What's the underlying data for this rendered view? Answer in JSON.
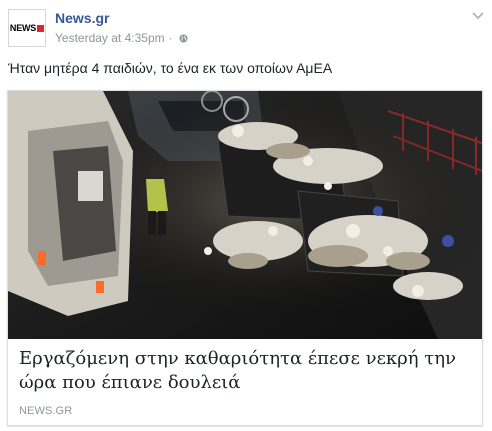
{
  "post": {
    "page_name": "News.gr",
    "timestamp": "Yesterday at 4:35pm",
    "separator": "·",
    "text": "Ήταν μητέρα 4 παιδιών, το ένα εκ των οποίων ΑμΕΑ"
  },
  "avatar": {
    "logo_text": "NEWS"
  },
  "link": {
    "headline": "Εργαζόμενη στην καθαριότητα έπεσε νεκρή την ώρα που έπιανε δουλειά",
    "domain": "NEWS.GR"
  },
  "colors": {
    "link_blue": "#365899",
    "meta_gray": "#90949c",
    "brand_red": "#e0262b"
  },
  "icons": [
    "globe-icon",
    "chevron-down-icon"
  ]
}
